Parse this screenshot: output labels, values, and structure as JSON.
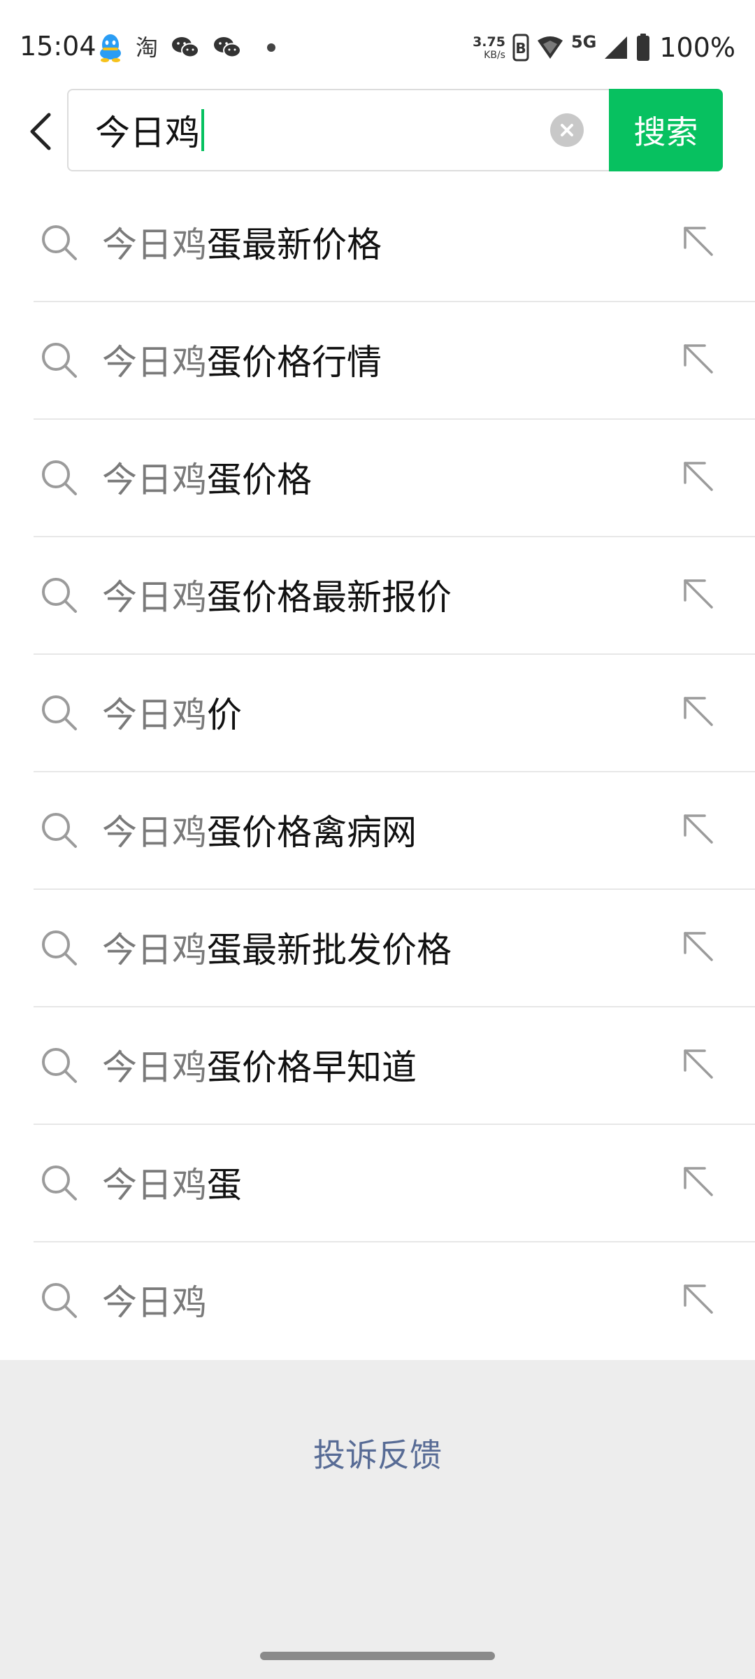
{
  "status_bar": {
    "time": "15:04",
    "left_icons": [
      "qq-icon",
      "taobao-icon",
      "wechat-icon",
      "wechat-icon",
      "dot-icon"
    ],
    "taobao_glyph": "淘",
    "net_speed_value": "3.75",
    "net_speed_unit": "KB/s",
    "network_type": "5G",
    "battery": "100%"
  },
  "search": {
    "query": "今日鸡",
    "button_label": "搜索"
  },
  "suggestions": [
    {
      "prefix": "今日鸡",
      "suffix": "蛋最新价格"
    },
    {
      "prefix": "今日鸡",
      "suffix": "蛋价格行情"
    },
    {
      "prefix": "今日鸡",
      "suffix": "蛋价格"
    },
    {
      "prefix": "今日鸡",
      "suffix": "蛋价格最新报价"
    },
    {
      "prefix": "今日鸡",
      "suffix": "价"
    },
    {
      "prefix": "今日鸡",
      "suffix": "蛋价格禽病网"
    },
    {
      "prefix": "今日鸡",
      "suffix": "蛋最新批发价格"
    },
    {
      "prefix": "今日鸡",
      "suffix": "蛋价格早知道"
    },
    {
      "prefix": "今日鸡",
      "suffix": "蛋"
    },
    {
      "prefix": "今日鸡",
      "suffix": ""
    }
  ],
  "footer": {
    "feedback_label": "投诉反馈"
  },
  "colors": {
    "accent_green": "#07c160",
    "link_blue": "#576b95",
    "footer_bg": "#ededed",
    "matched_prefix_gray": "#7a7a7a"
  }
}
